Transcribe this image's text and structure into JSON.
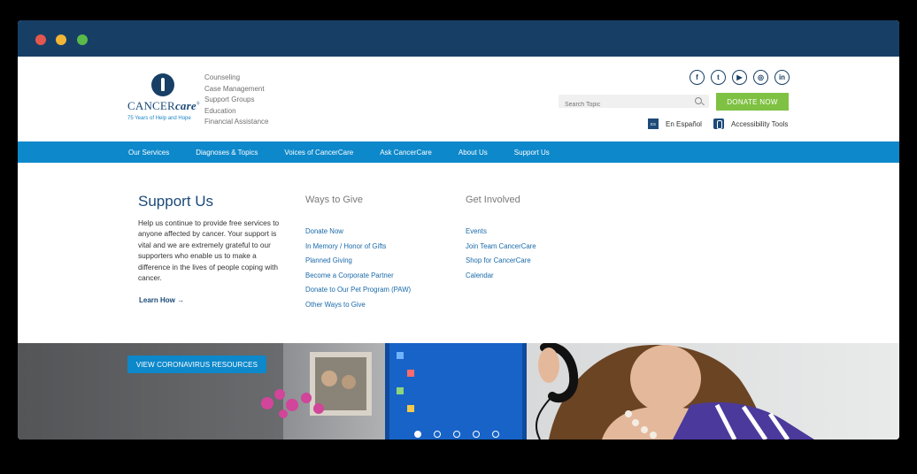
{
  "colors": {
    "titlebar": "#173f66",
    "nav": "#0d88cb",
    "donate": "#7fc142",
    "brand": "#1b4a79",
    "link": "#1a6aa9"
  },
  "logo": {
    "name_plain": "CANCER",
    "name_italic": "care",
    "reg": "®",
    "tagline": "75 Years of Help and Hope"
  },
  "topnav": [
    "Counseling",
    "Case Management",
    "Support Groups",
    "Education",
    "Financial Assistance"
  ],
  "social": [
    {
      "icon": "facebook-icon",
      "glyph": "f"
    },
    {
      "icon": "twitter-icon",
      "glyph": "t"
    },
    {
      "icon": "youtube-icon",
      "glyph": "▶"
    },
    {
      "icon": "instagram-icon",
      "glyph": "◎"
    },
    {
      "icon": "linkedin-icon",
      "glyph": "in"
    }
  ],
  "search": {
    "placeholder": "Search Topic"
  },
  "donate_label": "DONATE NOW",
  "language": {
    "badge": "ES",
    "label": "En Español"
  },
  "accessibility_label": "Accessibility Tools",
  "mainnav": [
    "Our Services",
    "Diagnoses & Topics",
    "Voices of CancerCare",
    "Ask CancerCare",
    "About Us",
    "Support Us"
  ],
  "support": {
    "title": "Support Us",
    "text": "Help us continue to provide free services to anyone affected by cancer. Your support is vital and we are extremely grateful to our supporters who enable us to make a difference in the lives of people coping with cancer.",
    "learn": "Learn How →"
  },
  "ways": {
    "heading": "Ways to Give",
    "links": [
      "Donate Now",
      "In Memory / Honor of Gifts",
      "Planned Giving",
      "Become a Corporate Partner",
      "Donate to Our Pet Program (PAW)",
      "Other Ways to Give"
    ]
  },
  "involved": {
    "heading": "Get Involved",
    "links": [
      "Events",
      "Join Team CancerCare",
      "Shop for CancerCare",
      "Calendar"
    ]
  },
  "hero": {
    "button": "VIEW CORONAVIRUS RESOURCES",
    "slides": 5,
    "active_slide": 1
  }
}
